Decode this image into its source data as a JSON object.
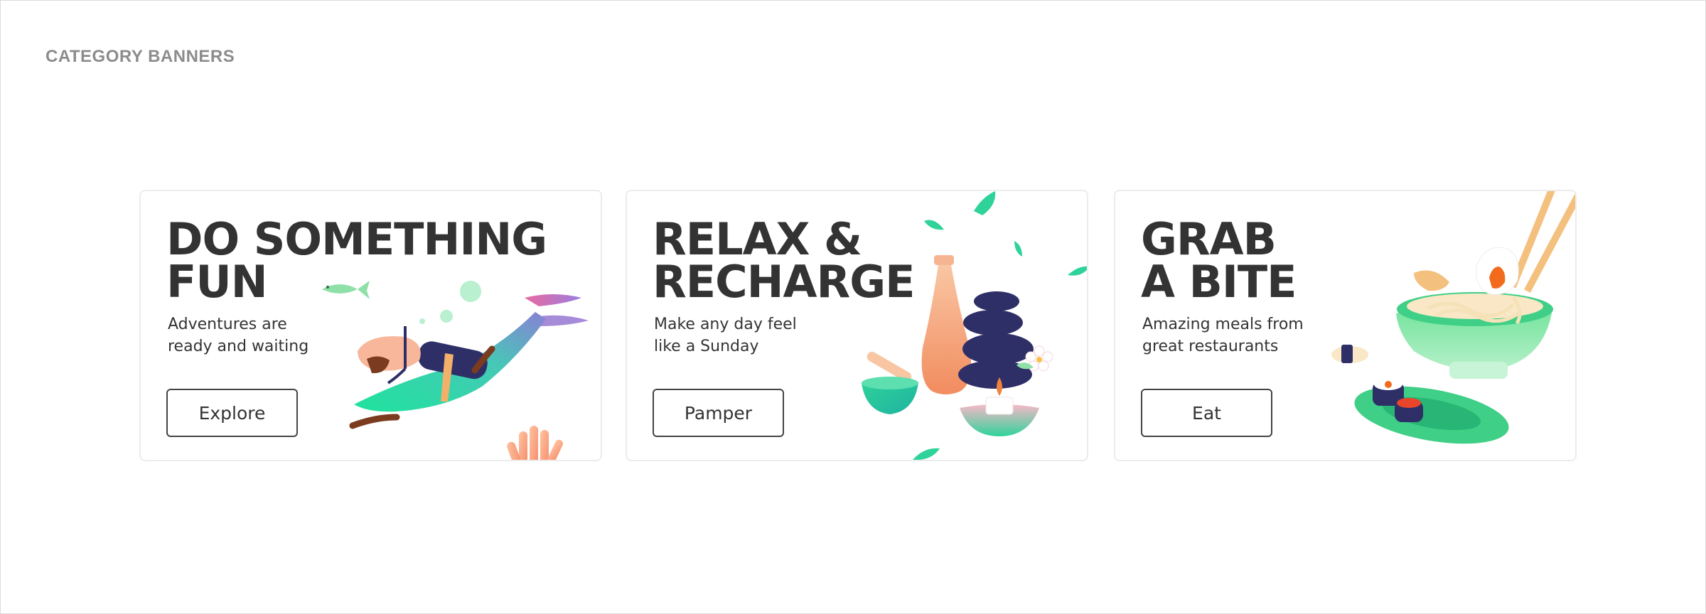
{
  "page": {
    "section_label": "CATEGORY BANNERS"
  },
  "banners": [
    {
      "title": "DO SOMETHING\nFUN",
      "subtitle": "Adventures are\nready and waiting",
      "cta_label": "Explore",
      "illustration": "scuba-diver-icon"
    },
    {
      "title": "RELAX &\nRECHARGE",
      "subtitle": "Make any day feel\nlike a Sunday",
      "cta_label": "Pamper",
      "illustration": "spa-icon"
    },
    {
      "title": "GRAB\nA BITE",
      "subtitle": "Amazing meals from\ngreat restaurants",
      "cta_label": "Eat",
      "illustration": "noodle-bowl-sushi-icon"
    }
  ],
  "colors": {
    "text": "#333333",
    "label": "#8c8c8c",
    "accent_green": "#2fd39a",
    "accent_orange": "#f08a5d",
    "accent_navy": "#2e2f66"
  }
}
